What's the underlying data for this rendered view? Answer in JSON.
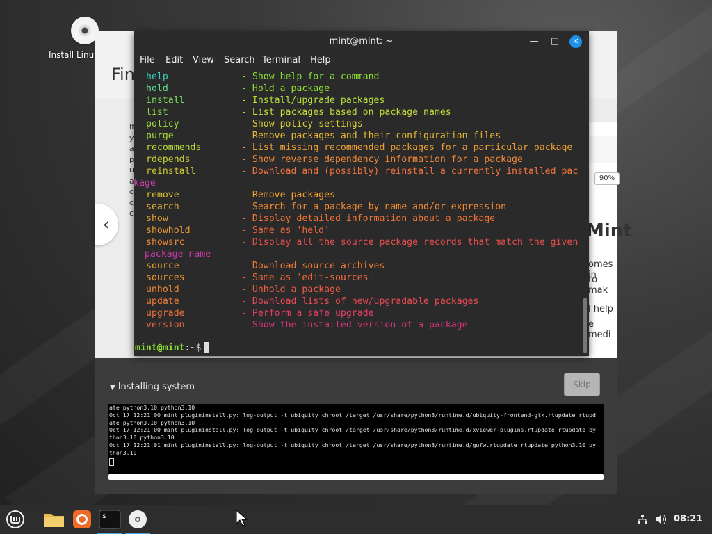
{
  "desktop": {
    "icon_label": "Install Linu"
  },
  "installer": {
    "title": "Fin",
    "left_text": [
      "If",
      "y",
      "a",
      "p",
      "u",
      "a",
      "c",
      "c",
      "c"
    ],
    "zoom": "90%",
    "slide": {
      "heading": "Mint",
      "lines": [
        "omes in",
        "to mak",
        "l help",
        "e medi"
      ]
    },
    "installing_label": "Installing system",
    "skip_label": "Skip",
    "log_lines": [
      "ate python3.10 python3.10",
      "Oct 17 12:21:00 mint plugininstall.py: log-output -t ubiquity chroot /target /usr/share/python3/runtime.d/ubiquity-frontend-gtk.rtupdate rtupd",
      "ate python3.10 python3.10",
      "Oct 17 12:21:00 mint plugininstall.py: log-output -t ubiquity chroot /target /usr/share/python3/runtime.d/xviewer-plugins.rtupdate rtupdate py",
      "thon3.10 python3.10",
      "Oct 17 12:21:01 mint plugininstall.py: log-output -t ubiquity chroot /target /usr/share/python3/runtime.d/gufw.rtupdate rtupdate python3.10 py",
      "thon3.10"
    ]
  },
  "terminal": {
    "title": "mint@mint: ~",
    "menu": [
      "File",
      "Edit",
      "View",
      "Search",
      "Terminal",
      "Help"
    ],
    "rows": [
      {
        "cmd": "help",
        "desc": "- Show help for a command",
        "cc": "#34d3c3",
        "dc": "#8ae234"
      },
      {
        "cmd": "hold",
        "desc": "- Hold a package",
        "cc": "#5ee08a",
        "dc": "#8ae234"
      },
      {
        "cmd": "install",
        "desc": "- Install/upgrade packages",
        "cc": "#7ee05a",
        "dc": "#b6e03a"
      },
      {
        "cmd": "list",
        "desc": "- List packages based on package names",
        "cc": "#8ee04a",
        "dc": "#c8d83a"
      },
      {
        "cmd": "policy",
        "desc": "- Show policy settings",
        "cc": "#9ee03e",
        "dc": "#d8cc34"
      },
      {
        "cmd": "purge",
        "desc": "- Remove packages and their configuration files",
        "cc": "#a8dc38",
        "dc": "#e8b832"
      },
      {
        "cmd": "recommends",
        "desc": "- List missing recommended packages for a particular package",
        "cc": "#b4d834",
        "dc": "#f0a032"
      },
      {
        "cmd": "rdepends",
        "desc": "- Show reverse dependency information for a package",
        "cc": "#c4d032",
        "dc": "#f48a38"
      },
      {
        "cmd": "reinstall",
        "desc": "- Download and (possibly) reinstall a currently installed pac",
        "cc": "#ccc832",
        "dc": "#f4743e"
      }
    ],
    "wrap1": "kage",
    "rows2": [
      {
        "cmd": "remove",
        "desc": "- Remove packages",
        "cc": "#d8bc34",
        "dc": "#f4a030"
      },
      {
        "cmd": "search",
        "desc": "- Search for a package by name and/or expression",
        "cc": "#e0b034",
        "dc": "#f48a30"
      },
      {
        "cmd": "show",
        "desc": "- Display detailed information about a package",
        "cc": "#e8a434",
        "dc": "#f47634"
      },
      {
        "cmd": "showhold",
        "desc": "- Same as 'held'",
        "cc": "#ec9834",
        "dc": "#f0663c"
      },
      {
        "cmd": "showsrc",
        "desc": "- Display all the source package records that match the given",
        "cc": "#ee8a34",
        "dc": "#e84e4e"
      }
    ],
    "wrap2": "  package name",
    "rows3": [
      {
        "cmd": "source",
        "desc": "- Download source archives",
        "cc": "#f0a030",
        "dc": "#f47a34"
      },
      {
        "cmd": "sources",
        "desc": "- Same as 'edit-sources'",
        "cc": "#f09632",
        "dc": "#f26a3a"
      },
      {
        "cmd": "unhold",
        "desc": "- Unhold a package",
        "cc": "#f08a34",
        "dc": "#ee5a44"
      },
      {
        "cmd": "update",
        "desc": "- Download lists of new/upgradable packages",
        "cc": "#f07c38",
        "dc": "#e84a54"
      },
      {
        "cmd": "upgrade",
        "desc": "- Perform a safe upgrade",
        "cc": "#ee703c",
        "dc": "#e23e64"
      },
      {
        "cmd": "version",
        "desc": "- Show the installed version of a package",
        "cc": "#ec6642",
        "dc": "#d8347a"
      }
    ],
    "prompt_user": "mint@mint",
    "prompt_rest": ":~$"
  },
  "taskbar": {
    "clock": "08:21"
  },
  "colors": {
    "wrap1": "#d040a8",
    "wrap2": "#c83aa8",
    "accent": "#4aa3df"
  }
}
